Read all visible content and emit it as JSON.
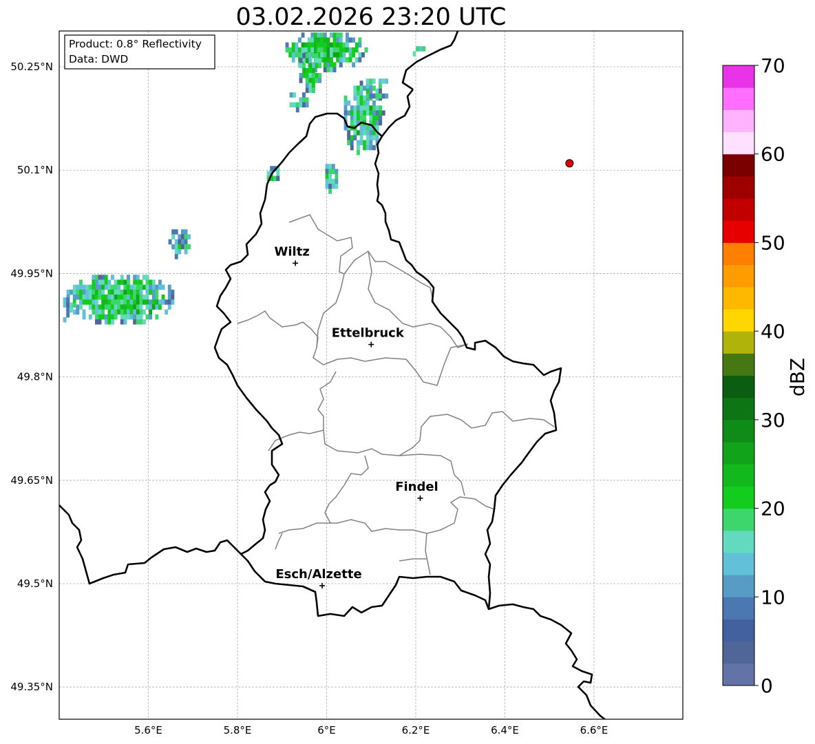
{
  "title": "03.02.2026 23:20 UTC",
  "info_box": {
    "product": "Product: 0.8° Reflectivity",
    "data_source": "Data: DWD"
  },
  "map": {
    "lat_ticks": [
      "50.25°N",
      "50.1°N",
      "49.95°N",
      "49.8°N",
      "49.65°N",
      "49.5°N",
      "49.35°N"
    ],
    "lon_ticks": [
      "5.6°E",
      "5.8°E",
      "6°E",
      "6.2°E",
      "6.4°E",
      "6.6°E"
    ],
    "cities": [
      {
        "name": "Wiltz",
        "lon": 5.93,
        "lat": 49.965
      },
      {
        "name": "Ettelbruck",
        "lon": 6.1,
        "lat": 49.847
      },
      {
        "name": "Findel",
        "lon": 6.21,
        "lat": 49.624
      },
      {
        "name": "Esch/Alzette",
        "lon": 5.99,
        "lat": 49.497
      }
    ],
    "marker": {
      "lon": 6.545,
      "lat": 50.11,
      "color": "#e00000"
    }
  },
  "colorbar": {
    "unit": "dBZ",
    "tick_labels": [
      "0",
      "10",
      "20",
      "30",
      "40",
      "50",
      "60",
      "70"
    ],
    "colors": [
      "#6373a8",
      "#506699",
      "#43609f",
      "#4b78b0",
      "#579cc4",
      "#63c0d9",
      "#63d9c0",
      "#3cd66c",
      "#13cc1d",
      "#13b81c",
      "#11a31a",
      "#0f8c17",
      "#0d7514",
      "#0b5e11",
      "#457813",
      "#afb30a",
      "#ffd600",
      "#ffb800",
      "#ff9c00",
      "#ff7f00",
      "#e60000",
      "#c20000",
      "#9e0000",
      "#7a0000",
      "#ffe0ff",
      "#ffb3ff",
      "#ff6eff",
      "#e833e8"
    ]
  }
}
